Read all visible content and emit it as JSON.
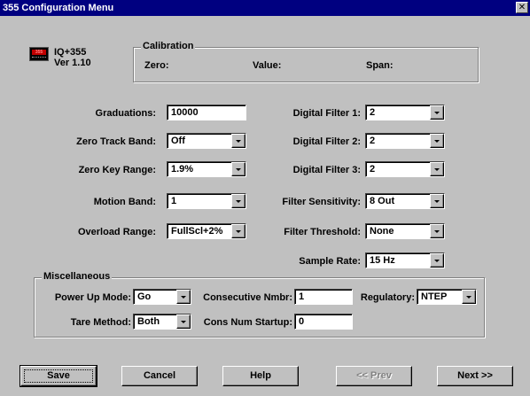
{
  "window": {
    "title": "355 Configuration Menu",
    "close_glyph": "✕"
  },
  "device": {
    "logo_text": "355",
    "name": "IQ+355",
    "version": "Ver 1.10"
  },
  "calibration": {
    "title": "Calibration",
    "zero_label": "Zero:",
    "value_label": "Value:",
    "span_label": "Span:"
  },
  "left_fields": {
    "graduations": {
      "label": "Graduations:",
      "value": "10000"
    },
    "zero_track_band": {
      "label": "Zero Track Band:",
      "value": "Off"
    },
    "zero_key_range": {
      "label": "Zero Key Range:",
      "value": "1.9%"
    },
    "motion_band": {
      "label": "Motion Band:",
      "value": "1"
    },
    "overload_range": {
      "label": "Overload Range:",
      "value": "FullScl+2%"
    }
  },
  "right_fields": {
    "digital_filter_1": {
      "label": "Digital Filter 1:",
      "value": "2"
    },
    "digital_filter_2": {
      "label": "Digital Filter 2:",
      "value": "2"
    },
    "digital_filter_3": {
      "label": "Digital Filter 3:",
      "value": "2"
    },
    "filter_sensitivity": {
      "label": "Filter Sensitivity:",
      "value": "8 Out"
    },
    "filter_threshold": {
      "label": "Filter Threshold:",
      "value": "None"
    },
    "sample_rate": {
      "label": "Sample Rate:",
      "value": "15 Hz"
    }
  },
  "misc": {
    "title": "Miscellaneous",
    "power_up_mode": {
      "label": "Power Up Mode:",
      "value": "Go"
    },
    "tare_method": {
      "label": "Tare Method:",
      "value": "Both"
    },
    "consecutive_nmbr": {
      "label": "Consecutive Nmbr:",
      "value": "1"
    },
    "cons_num_startup": {
      "label": "Cons Num Startup:",
      "value": "0"
    },
    "regulatory": {
      "label": "Regulatory:",
      "value": "NTEP"
    }
  },
  "buttons": {
    "save": "Save",
    "cancel": "Cancel",
    "help": "Help",
    "prev": "<< Prev",
    "next": "Next >>"
  },
  "colors": {
    "titlebar": "#000080",
    "face": "#c0c0c0",
    "logo_display": "#c00000"
  }
}
